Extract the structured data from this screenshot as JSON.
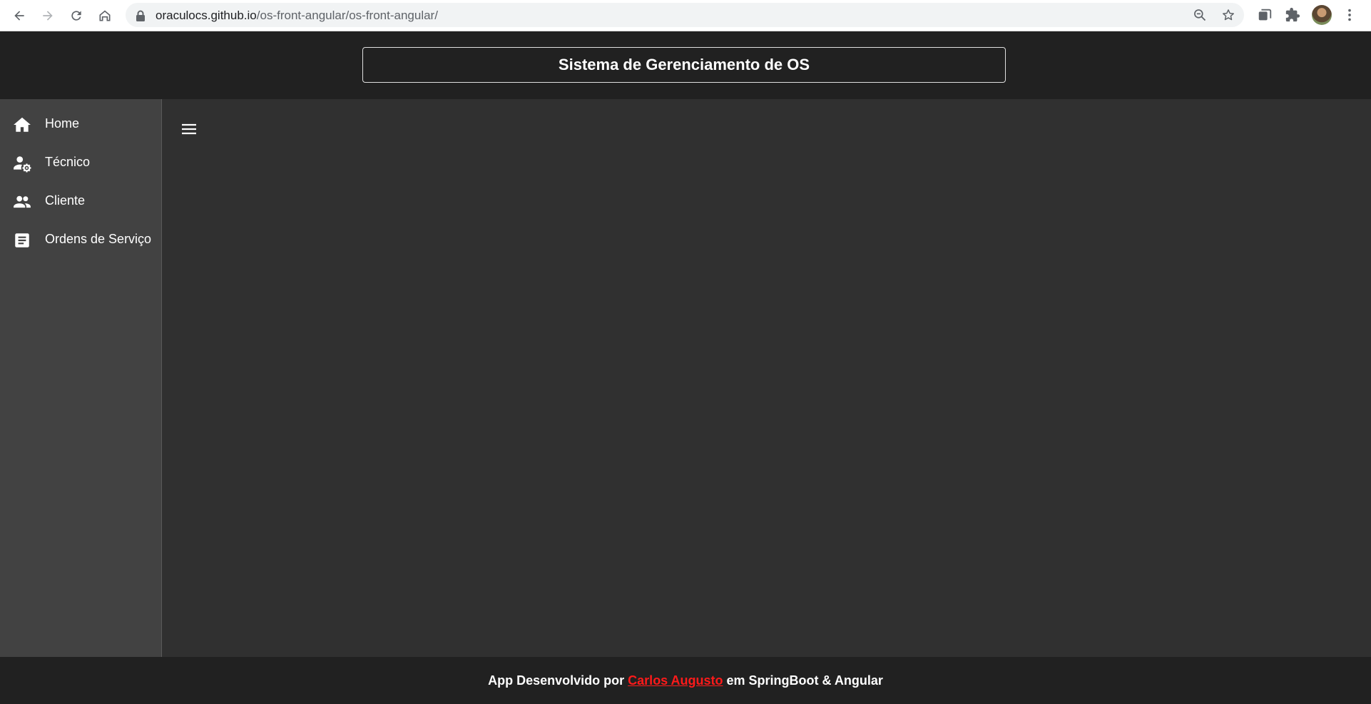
{
  "browser": {
    "url_host": "oraculocs.github.io",
    "url_path": "/os-front-angular/os-front-angular/",
    "icons": {
      "back": "arrow-left-icon",
      "forward": "arrow-right-icon",
      "reload": "reload-icon",
      "home": "home-icon",
      "lock": "lock-icon",
      "zoom": "zoom-out-icon",
      "bookmark": "star-icon",
      "tabs": "tab-search-icon",
      "extensions": "puzzle-icon",
      "menu": "kebab-menu-icon"
    }
  },
  "app": {
    "title": "Sistema de Gerenciamento de OS"
  },
  "sidenav": {
    "items": [
      {
        "label": "Home",
        "icon": "home-icon"
      },
      {
        "label": "Técnico",
        "icon": "user-gear-icon"
      },
      {
        "label": "Cliente",
        "icon": "people-icon"
      },
      {
        "label": "Ordens de Serviço",
        "icon": "document-icon"
      }
    ]
  },
  "content": {
    "menu_icon": "hamburger-menu-icon"
  },
  "footer": {
    "prefix": "App Desenvolvido por ",
    "author": "Carlos Augusto",
    "suffix": " em SpringBoot & Angular"
  },
  "colors": {
    "toolbar": "#212121",
    "sidenav": "#424242",
    "content": "#303030",
    "footer_link": "#ff1a1a"
  }
}
